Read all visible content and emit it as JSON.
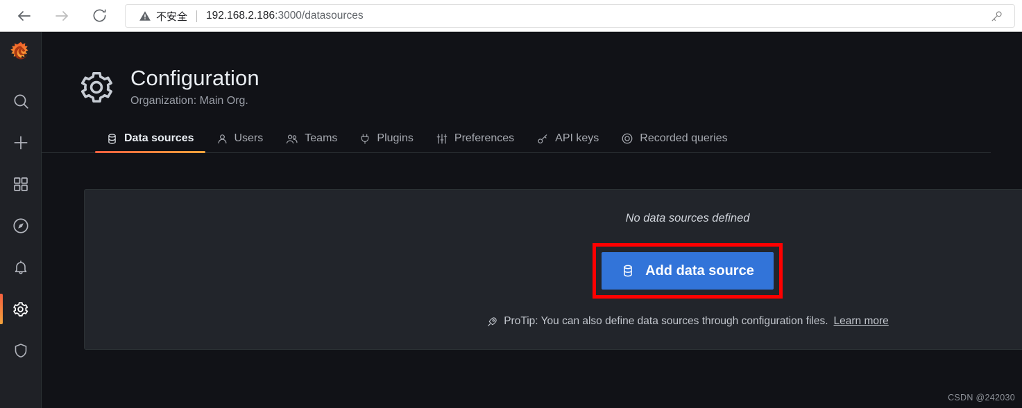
{
  "browser": {
    "back_label": "Back",
    "forward_label": "Forward",
    "reload_label": "Reload",
    "security_text": "不安全",
    "url_host": "192.168.2.186",
    "url_path": ":3000/datasources",
    "password_key_label": "Passwords"
  },
  "sidebar": {
    "logo_label": "Grafana",
    "items": [
      {
        "name": "search",
        "label": "Search"
      },
      {
        "name": "create",
        "label": "Create"
      },
      {
        "name": "dashboards",
        "label": "Dashboards"
      },
      {
        "name": "explore",
        "label": "Explore"
      },
      {
        "name": "alerting",
        "label": "Alerting"
      },
      {
        "name": "configuration",
        "label": "Configuration",
        "active": true
      },
      {
        "name": "server-admin",
        "label": "Server Admin"
      }
    ]
  },
  "page": {
    "title": "Configuration",
    "subtitle": "Organization: Main Org.",
    "icon": "gear-icon"
  },
  "tabs": [
    {
      "label": "Data sources",
      "icon": "database-icon",
      "active": true
    },
    {
      "label": "Users",
      "icon": "user-icon",
      "active": false
    },
    {
      "label": "Teams",
      "icon": "users-icon",
      "active": false
    },
    {
      "label": "Plugins",
      "icon": "plug-icon",
      "active": false
    },
    {
      "label": "Preferences",
      "icon": "sliders-icon",
      "active": false
    },
    {
      "label": "API keys",
      "icon": "key-icon",
      "active": false
    },
    {
      "label": "Recorded queries",
      "icon": "record-icon",
      "active": false
    }
  ],
  "empty_state": {
    "title": "No data sources defined",
    "add_button_label": "Add data source",
    "protip_prefix": "ProTip: You can also define data sources through configuration files.",
    "protip_link": "Learn more"
  },
  "watermark": "CSDN @242030",
  "colors": {
    "accent_orange": "#f55f3e",
    "accent_yellow": "#f2a33c",
    "primary_blue": "#3274d9",
    "highlight_red": "#ff0000",
    "app_bg": "#111217",
    "panel_bg": "#22252b",
    "sidebar_bg": "#1f2126"
  }
}
